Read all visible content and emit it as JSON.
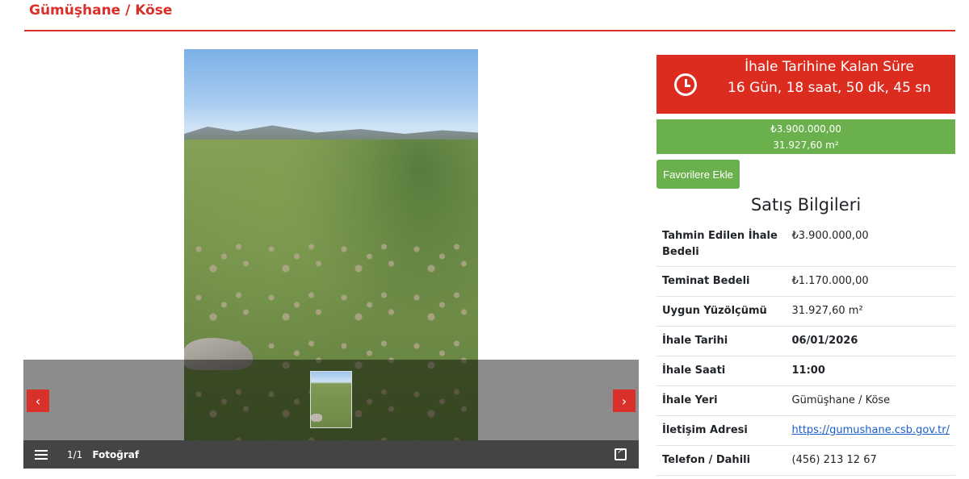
{
  "header": {
    "title": "Gümüşhane / Köse"
  },
  "gallery": {
    "counter": "1/1",
    "photo_label": "Fotoğraf",
    "prev_icon": "chevron-left-icon",
    "next_icon": "chevron-right-icon",
    "prev_glyph": "‹",
    "next_glyph": "›"
  },
  "countdown": {
    "title": "İhale Tarihine Kalan Süre",
    "value": "16 Gün, 18 saat, 50 dk, 45 sn"
  },
  "summary": {
    "price": "₺3.900.000,00",
    "area": "31.927,60 m²"
  },
  "actions": {
    "favorite_label": "Favorilere Ekle"
  },
  "sale_info": {
    "title": "Satış Bilgileri",
    "rows": [
      {
        "label": "Tahmin Edilen İhale Bedeli",
        "value": "₺3.900.000,00"
      },
      {
        "label": "Teminat Bedeli",
        "value": "₺1.170.000,00"
      },
      {
        "label": "Uygun Yüzölçümü",
        "value": "31.927,60 m²"
      },
      {
        "label": "İhale Tarihi",
        "value": "06/01/2026"
      },
      {
        "label": "İhale Saati",
        "value": "11:00"
      },
      {
        "label": "İhale Yeri",
        "value": "Gümüşhane / Köse"
      },
      {
        "label": "İletişim Adresi",
        "value": "https://gumushane.csb.gov.tr/"
      },
      {
        "label": "Telefon / Dahili",
        "value": "(456) 213 12 67"
      }
    ]
  },
  "colors": {
    "accent_red": "#dc2b1f",
    "accent_green": "#6ab04c",
    "link_blue": "#1a5ecc"
  }
}
